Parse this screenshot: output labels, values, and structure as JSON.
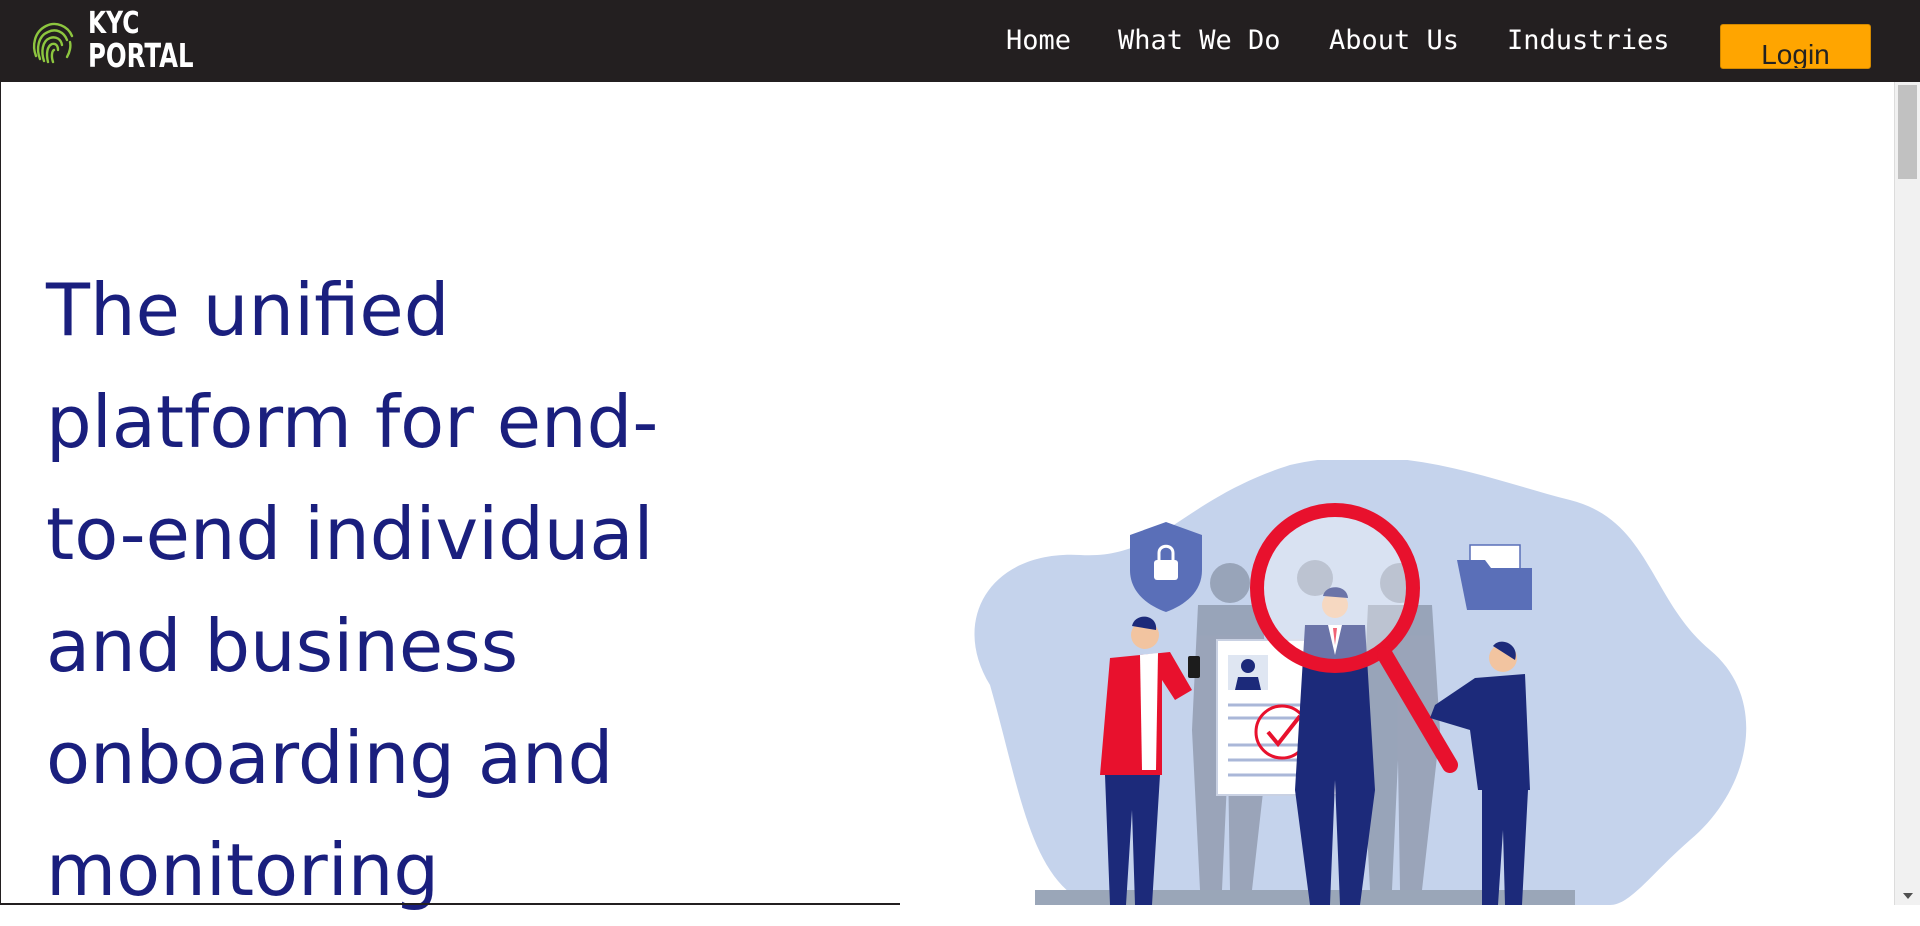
{
  "brand": {
    "line1": "KYC",
    "line2": "PORTAL"
  },
  "nav": {
    "home": "Home",
    "what_we_do": "What We Do",
    "about_us": "About Us",
    "industries": "Industries",
    "login": "Login"
  },
  "hero": {
    "lines": [
      "The unified",
      "platform for end-",
      "to-end individual",
      "and business",
      "onboarding and",
      "monitoring"
    ]
  },
  "colors": {
    "header_bg": "#231f20",
    "accent": "#ffa500",
    "heading": "#1a1f7e",
    "logo_green": "#8dc63f"
  },
  "icons": [
    "fingerprint-icon",
    "lock-shield-icon",
    "folder-icon",
    "magnifier-icon",
    "check-icon"
  ]
}
